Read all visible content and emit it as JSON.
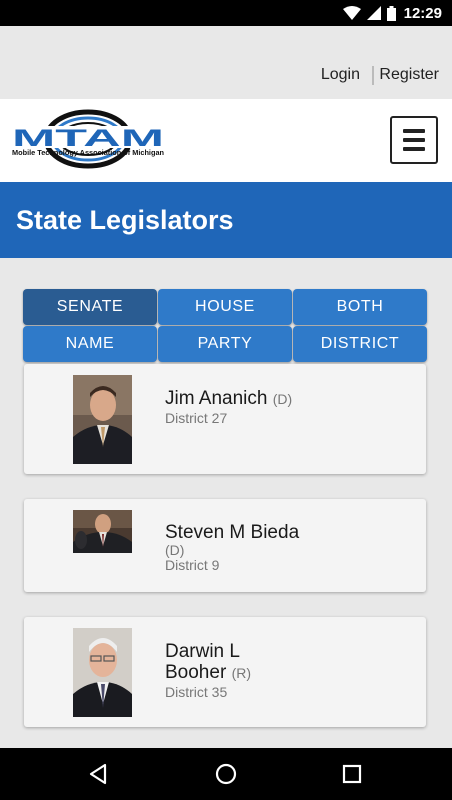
{
  "status_bar": {
    "time": "12:29"
  },
  "auth": {
    "login_label": "Login",
    "register_label": "Register"
  },
  "header": {
    "logo_text": "MTAM",
    "logo_subtitle": "Mobile Technology Association of Michigan",
    "accent_color": "#1f66b8"
  },
  "page": {
    "title": "State Legislators"
  },
  "filters": {
    "chamber": [
      "SENATE",
      "HOUSE",
      "BOTH"
    ],
    "chamber_selected": "SENATE",
    "sort": [
      "NAME",
      "PARTY",
      "DISTRICT"
    ]
  },
  "legislators": [
    {
      "name": "Jim Ananich",
      "party": "(D)",
      "district": "District 27"
    },
    {
      "name": "Steven M Bieda",
      "party": "(D)",
      "district": "District 9"
    },
    {
      "name_line1": "Darwin L",
      "name_line2": "Booher",
      "party": "(R)",
      "district": "District 35"
    }
  ]
}
